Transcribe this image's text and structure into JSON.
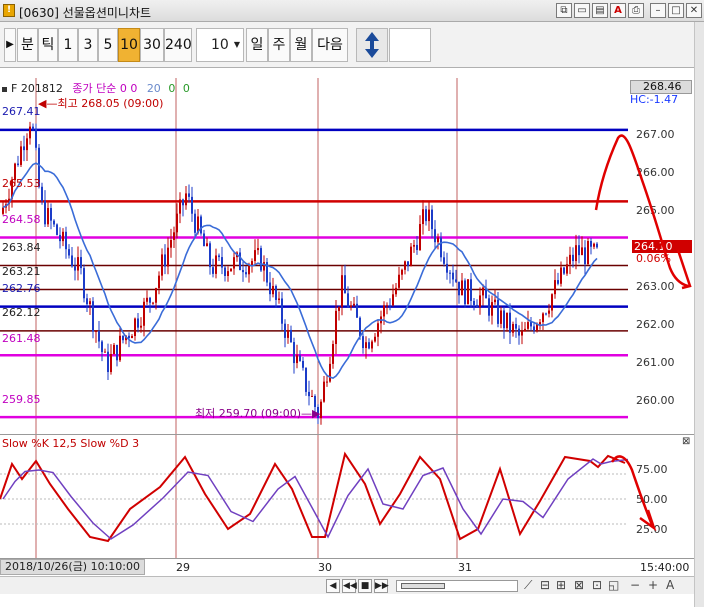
{
  "window": {
    "icon": "!",
    "title": "[0630] 선물옵션미니차트",
    "buttons": [
      "window-link-icon",
      "window-restore-icon",
      "settings-icon",
      "a-text-icon",
      "print-icon",
      "minimize-icon",
      "maximize-icon",
      "close-icon"
    ]
  },
  "toolbar": {
    "period_buttons": [
      "분",
      "틱",
      "1",
      "3",
      "5",
      "10",
      "30",
      "240"
    ],
    "active_period": "10",
    "interval_value": "10",
    "range_buttons": [
      "일",
      "주",
      "월",
      "다음"
    ],
    "nav_arrow": "▶"
  },
  "legend": {
    "symbol": "F 201812",
    "indicator": "종가 단순",
    "values": [
      "0",
      "0",
      "20",
      "0",
      "0"
    ]
  },
  "annotations": {
    "high": "최고 268.05 (09:00)",
    "low": "최저 259.70 (09:00)"
  },
  "level_labels": [
    {
      "text": "267.41",
      "color": "blue"
    },
    {
      "text": "265.53",
      "color": "red"
    },
    {
      "text": "264.58",
      "color": "pink"
    },
    {
      "text": "263.84",
      "color": "dark"
    },
    {
      "text": "263.21",
      "color": "dark"
    },
    {
      "text": "262.76",
      "color": "blue"
    },
    {
      "text": "262.12",
      "color": "dark"
    },
    {
      "text": "261.48",
      "color": "pink"
    },
    {
      "text": "259.85",
      "color": "pink"
    }
  ],
  "price_axis": {
    "top_tag": "268.46",
    "hc_label": "HC:-1.47",
    "ticks": [
      "267.00",
      "266.00",
      "265.00",
      "264.00",
      "263.00",
      "262.00",
      "261.00",
      "260.00"
    ],
    "current_tag": "264.10",
    "change_pct": "0.06%"
  },
  "oscillator": {
    "legend": "Slow %K 12,5  Slow %D 3",
    "ticks": [
      "75.00",
      "50.00",
      "25.00"
    ]
  },
  "date_axis": {
    "cursor": "2018/10/26(금) 10:10:00",
    "dates": [
      "29",
      "30",
      "31"
    ],
    "time": "15:40:00"
  },
  "bottom_bar": {
    "nav": [
      "◀",
      "◀◀",
      "■",
      "▶▶"
    ],
    "tools": [
      "−",
      "+",
      "A"
    ]
  },
  "colors": {
    "up": "#c00000",
    "down": "#1c3cc8",
    "ma": "#3a6cd8",
    "level_blue": "#0000c0",
    "level_red": "#d00000",
    "level_pink": "#e000e0",
    "level_dark": "#6a0000",
    "accent": "#f0b232",
    "osc_k": "#d00000",
    "osc_d": "#7040c0"
  }
}
